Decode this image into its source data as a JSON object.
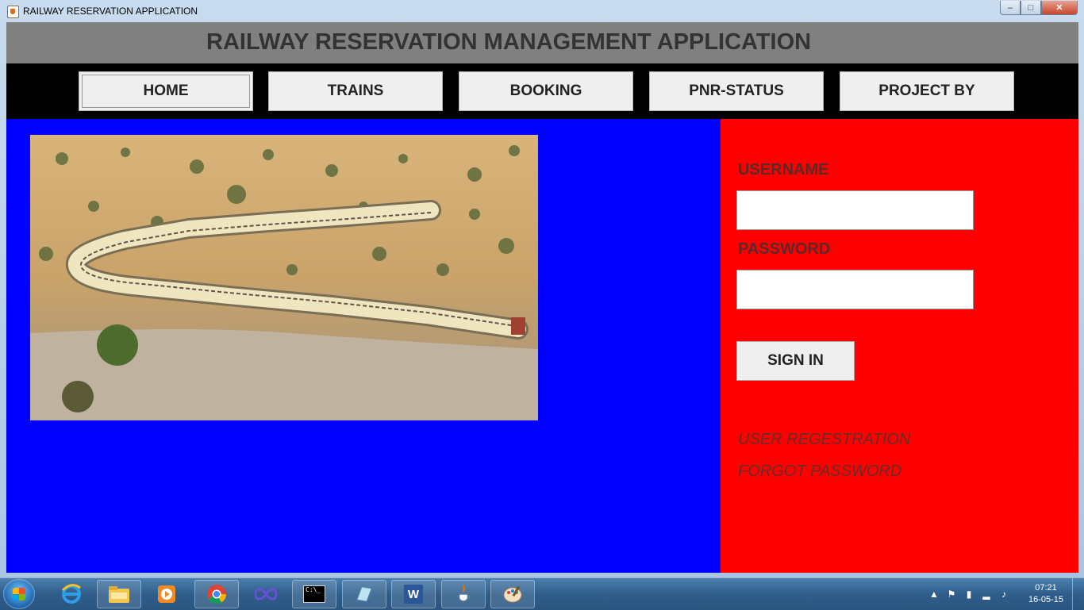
{
  "window": {
    "title": "RAILWAY RESERVATION APPLICATION",
    "controls": {
      "minimize": "–",
      "maximize": "□",
      "close": "✕"
    }
  },
  "header": {
    "title": "RAILWAY RESERVATION MANAGEMENT APPLICATION"
  },
  "nav": {
    "items": [
      {
        "label": "HOME",
        "active": true
      },
      {
        "label": "TRAINS"
      },
      {
        "label": "BOOKING"
      },
      {
        "label": "PNR-STATUS"
      },
      {
        "label": "PROJECT BY"
      }
    ]
  },
  "login": {
    "username_label": "USERNAME",
    "username_value": "",
    "password_label": "PASSWORD",
    "password_value": "",
    "sign_in_label": "SIGN IN",
    "user_registration_link": "USER REGESTRATION",
    "forgot_password_link": "FORGOT PASSWORD"
  },
  "colors": {
    "header_bg": "#808080",
    "nav_bg": "#000000",
    "left_panel_bg": "#0000ff",
    "right_panel_bg": "#ff0000"
  },
  "taskbar": {
    "apps": [
      {
        "name": "internet-explorer-icon"
      },
      {
        "name": "file-explorer-icon"
      },
      {
        "name": "media-player-icon"
      },
      {
        "name": "chrome-icon"
      },
      {
        "name": "infinity-app-icon"
      },
      {
        "name": "command-prompt-icon",
        "label": "C:\\_"
      },
      {
        "name": "notepad-icon"
      },
      {
        "name": "word-icon",
        "label": "W"
      },
      {
        "name": "java-icon"
      },
      {
        "name": "paint-icon"
      }
    ],
    "clock_time": "07:21",
    "clock_date": "16-05-15"
  }
}
